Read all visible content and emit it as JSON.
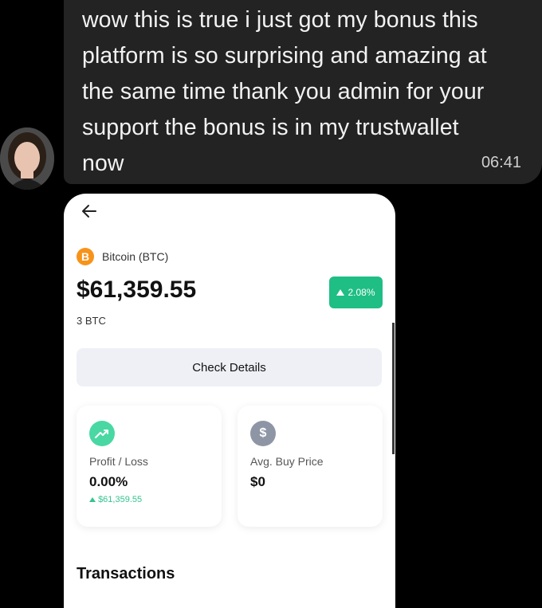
{
  "chat": {
    "message": "wow this is true i just got my bonus this platform is so surprising and amazing at the same time thank you admin for your support the bonus is in my trustwallet now",
    "time": "06:41"
  },
  "wallet": {
    "coin_symbol_glyph": "B",
    "coin_name": "Bitcoin (BTC)",
    "balance": "$61,359.55",
    "change_pct": "2.08%",
    "change_direction": "up",
    "holding_amount": "3 BTC",
    "check_details_label": "Check Details",
    "profit_loss": {
      "label": "Profit / Loss",
      "value": "0.00%",
      "sub_value": "$61,359.55"
    },
    "avg_buy_price": {
      "label": "Avg. Buy Price",
      "value": "$0",
      "icon_glyph": "$"
    },
    "transactions_title": "Transactions"
  },
  "colors": {
    "bubble_bg": "#232323",
    "positive": "#1fbe84",
    "btc_orange": "#f7931a",
    "button_bg": "#eef0f6"
  }
}
